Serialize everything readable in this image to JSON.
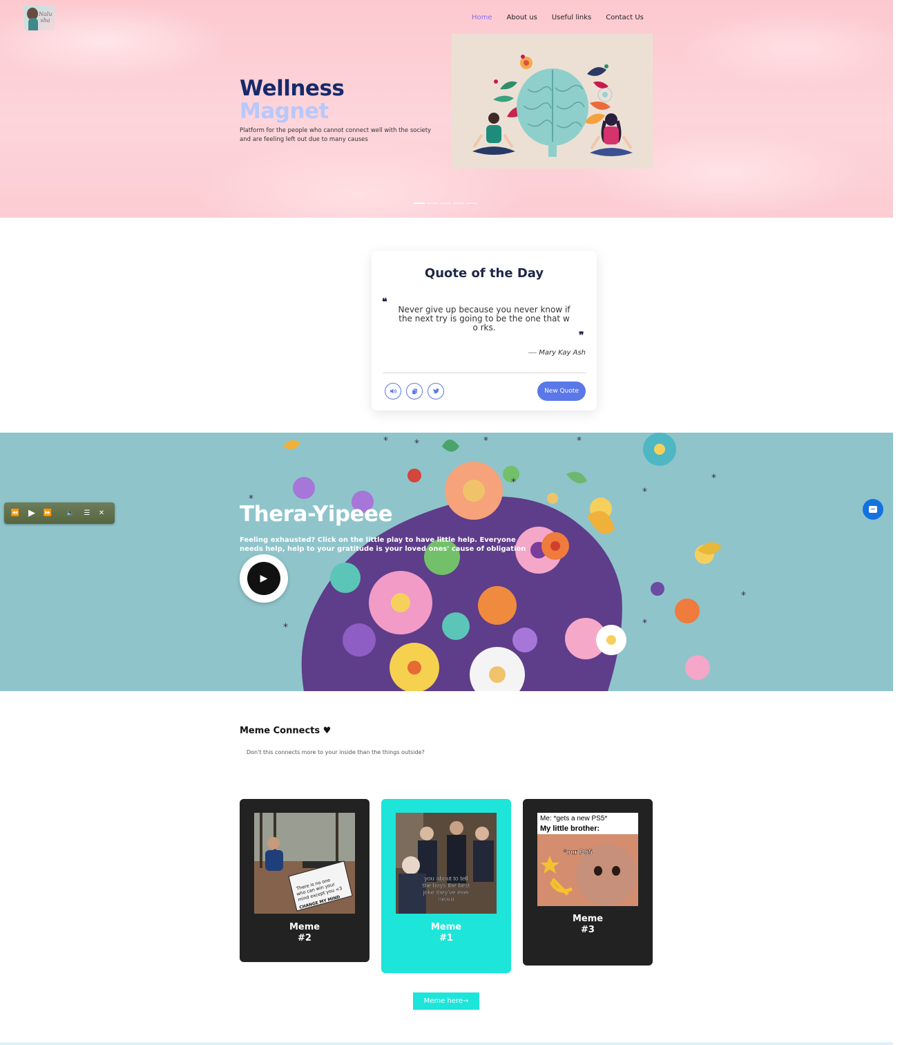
{
  "nav": {
    "items": [
      {
        "label": "Home",
        "active": true
      },
      {
        "label": "About us"
      },
      {
        "label": "Useful links"
      },
      {
        "label": "Contact Us"
      }
    ]
  },
  "hero": {
    "title_line1": "Wellness",
    "title_line2": "Magnet",
    "subtitle": "Platform for the people who cannot connect well with the society and are feeling left out due to many causes",
    "slides": 5,
    "active_slide": 1
  },
  "quote": {
    "title": "Quote of the Day",
    "text": "Never give up because you never know if the next try is going to be the one that wo rks.",
    "author": "Mary Kay Ash",
    "buttons": {
      "speak_icon": "speaker-icon",
      "copy_icon": "copy-icon",
      "tweet_icon": "twitter-icon",
      "new_quote": "New Quote"
    }
  },
  "thera": {
    "title": "Thera-Yipeee",
    "subtitle": "Feeling exhausted? Click on the little play to have little help. Everyone needs help, help to your gratitude is your loved ones' cause of obligation"
  },
  "player": {
    "prev": "⏪",
    "play": "▶",
    "next": "⏩",
    "volume": "🔈",
    "playlist": "☰",
    "close": "✕"
  },
  "memes": {
    "heading": "Meme Connects ♥",
    "subtitle": "Don't this connects more to your inside than the things outside?",
    "cards": [
      {
        "caption_line1": "Meme",
        "caption_line2": "#2",
        "img_text": "There is no one who can win your mind except you <3",
        "sign_text": "CHANGE MY MIND"
      },
      {
        "caption_line1": "Meme",
        "caption_line2": "#1",
        "img_text": "you about to tell the boys the best joke they've ever heard"
      },
      {
        "caption_line1": "Meme",
        "caption_line2": "#3",
        "img_top1": "Me: *gets a new PS5*",
        "img_top2": "My little brother:",
        "img_text": "*our PS5"
      }
    ],
    "button": "Meme here→"
  },
  "colors": {
    "navy": "#172a6b",
    "lavender": "#b8c8fa",
    "accent_blue": "#5b78e8",
    "teal": "#1de5d9",
    "dark_card": "#222222"
  }
}
